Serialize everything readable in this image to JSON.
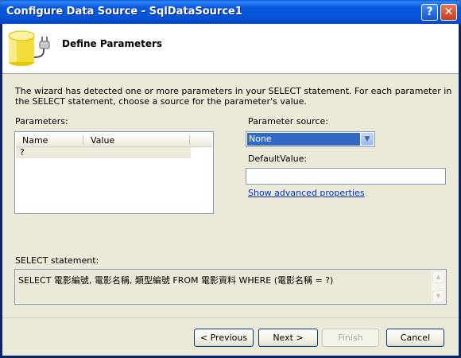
{
  "window": {
    "title": "Configure Data Source - SqlDataSource1",
    "help_button": "?",
    "close_button": "✕"
  },
  "header": {
    "heading": "Define Parameters",
    "icon": "database-connector-icon"
  },
  "description": "The wizard has detected one or more parameters in your SELECT statement. For each parameter in the SELECT statement, choose a source for the parameter's value.",
  "parameters": {
    "label": "Parameters:",
    "columns": [
      "Name",
      "Value"
    ],
    "rows": [
      {
        "name": "?",
        "value": ""
      }
    ]
  },
  "parameter_source": {
    "label": "Parameter source:",
    "selected": "None"
  },
  "default_value": {
    "label": "DefaultValue:",
    "value": ""
  },
  "advanced_link": "Show advanced properties",
  "select_statement": {
    "label": "SELECT statement:",
    "sql": "SELECT 電影編號, 電影名稱, 類型編號 FROM 電影資料 WHERE (電影名稱 = ?)"
  },
  "buttons": {
    "previous": "< Previous",
    "next": "Next >",
    "finish": "Finish",
    "cancel": "Cancel"
  }
}
